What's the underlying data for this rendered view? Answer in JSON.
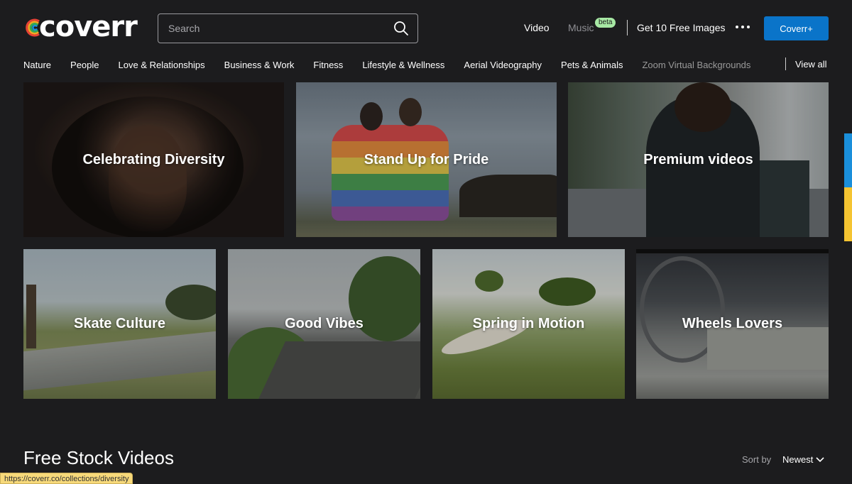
{
  "brand": {
    "logo_text": "coverr"
  },
  "search": {
    "placeholder": "Search"
  },
  "topnav": {
    "video": "Video",
    "music": "Music",
    "music_badge": "beta",
    "free_images": "Get 10 Free Images",
    "cta": "Coverr+"
  },
  "categories": [
    "Nature",
    "People",
    "Love & Relationships",
    "Business & Work",
    "Fitness",
    "Lifestyle & Wellness",
    "Aerial Videography",
    "Pets & Animals",
    "Zoom Virtual Backgrounds"
  ],
  "view_all": "View all",
  "collections": [
    {
      "title": "Celebrating Diversity"
    },
    {
      "title": "Stand Up for Pride"
    },
    {
      "title": "Premium videos"
    },
    {
      "title": "Skate Culture"
    },
    {
      "title": "Good Vibes"
    },
    {
      "title": "Spring in Motion"
    },
    {
      "title": "Wheels Lovers"
    }
  ],
  "section": {
    "title": "Free Stock Videos"
  },
  "sort": {
    "label": "Sort by",
    "value": "Newest"
  },
  "status_bar": {
    "url": "https://coverr.co/collections/diversity"
  },
  "colors": {
    "background": "#1c1c1e",
    "accent": "#0a74c9",
    "beta_badge": "#a7e8a4"
  }
}
